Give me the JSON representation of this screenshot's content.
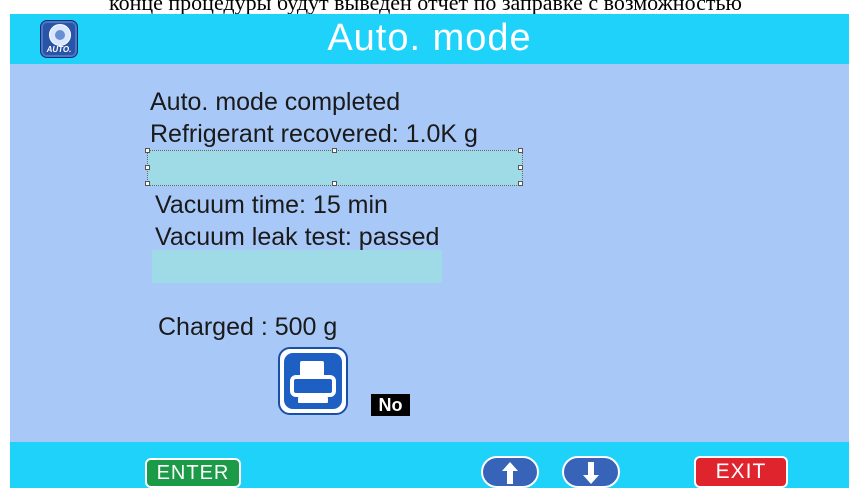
{
  "caption": "конце процедуры будут выведен отчет по заправке с возможностью",
  "header": {
    "title": "Auto. mode",
    "mode_icon_text": "AUTO."
  },
  "report": {
    "status": "Auto. mode completed",
    "refrigerant_recovered": "Refrigerant recovered: 1.0K g",
    "vacuum_time": "Vacuum time: 15 min",
    "vacuum_leak_test": "Vacuum leak test: passed",
    "charged": "Charged : 500 g"
  },
  "print": {
    "icon": "printer-icon",
    "option_label": "No"
  },
  "footer": {
    "enter_label": "ENTER",
    "up_icon": "arrow-up-icon",
    "down_icon": "arrow-down-icon",
    "exit_label": "EXIT"
  },
  "colors": {
    "title_bar": "#1fd2fa",
    "screen_bg": "#a8c9f7",
    "highlight": "#9edbe6",
    "enter": "#1b9a48",
    "exit": "#e0242e",
    "arrow": "#3763b8"
  }
}
